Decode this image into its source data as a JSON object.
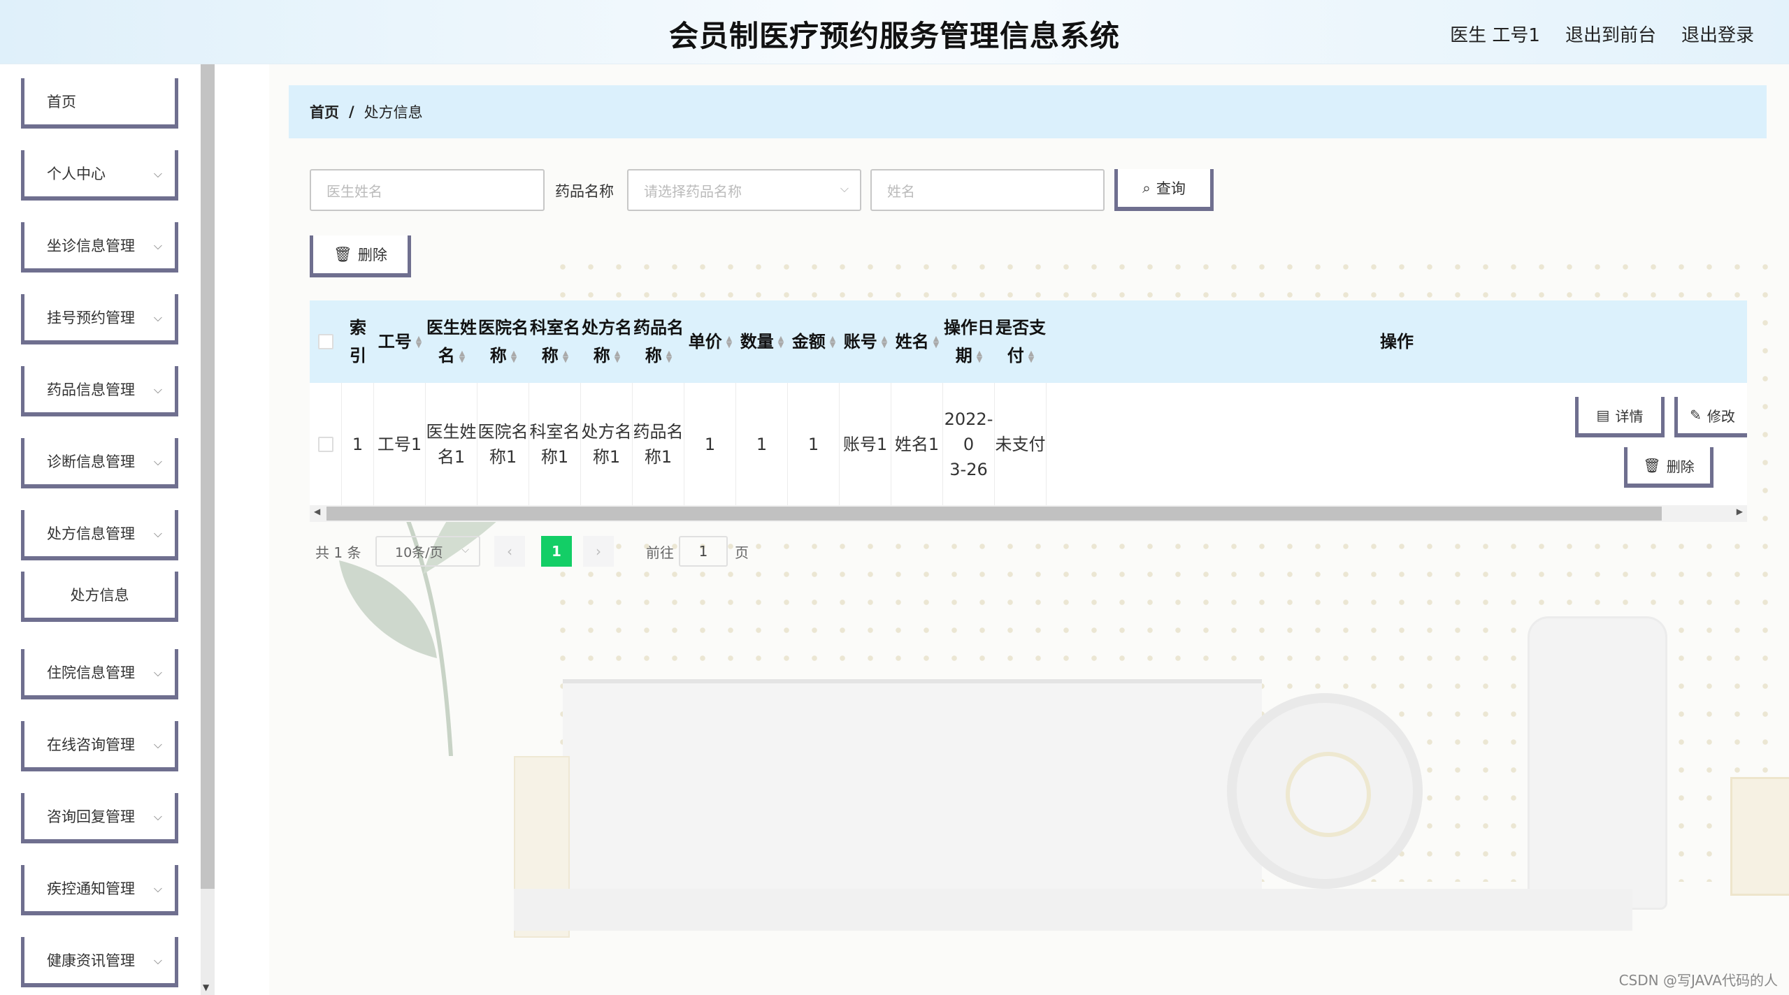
{
  "header": {
    "title": "会员制医疗预约服务管理信息系统",
    "user": "医生 工号1",
    "to_front": "退出到前台",
    "logout": "退出登录"
  },
  "sidebar": {
    "items": [
      {
        "label": "首页"
      },
      {
        "label": "个人中心"
      },
      {
        "label": "坐诊信息管理"
      },
      {
        "label": "挂号预约管理"
      },
      {
        "label": "药品信息管理"
      },
      {
        "label": "诊断信息管理"
      },
      {
        "label": "处方信息管理"
      },
      {
        "label": "处方信息"
      },
      {
        "label": "住院信息管理"
      },
      {
        "label": "在线咨询管理"
      },
      {
        "label": "咨询回复管理"
      },
      {
        "label": "疾控通知管理"
      },
      {
        "label": "健康资讯管理"
      }
    ]
  },
  "breadcrumb": {
    "home": "首页",
    "sep": "/",
    "current": "处方信息"
  },
  "search": {
    "doctor_placeholder": "医生姓名",
    "drug_label": "药品名称",
    "drug_placeholder": "请选择药品名称",
    "name_placeholder": "姓名",
    "query_button": "查询"
  },
  "actions": {
    "delete_button": "删除"
  },
  "table": {
    "headers": {
      "index": [
        "索",
        "引"
      ],
      "staff_no": "工号",
      "doctor_name": [
        "医生姓",
        "名"
      ],
      "hospital": [
        "医院名",
        "称"
      ],
      "dept": [
        "科室名",
        "称"
      ],
      "prescription": [
        "处方名",
        "称"
      ],
      "drug": [
        "药品名",
        "称"
      ],
      "unit_price": "单价",
      "quantity": "数量",
      "amount": "金额",
      "account": "账号",
      "name": "姓名",
      "op_date": [
        "操作日",
        "期"
      ],
      "paid": [
        "是否支",
        "付"
      ],
      "operation": "操作"
    },
    "row": {
      "index": "1",
      "staff_no": "工号1",
      "doctor_name": [
        "医生姓",
        "名1"
      ],
      "hospital": [
        "医院名",
        "称1"
      ],
      "dept": [
        "科室名",
        "称1"
      ],
      "prescription": [
        "处方名",
        "称1"
      ],
      "drug": [
        "药品名",
        "称1"
      ],
      "unit_price": "1",
      "quantity": "1",
      "amount": "1",
      "account": "账号1",
      "name": "姓名1",
      "op_date": [
        "2022-0",
        "3-26"
      ],
      "paid": "未支付",
      "detail": "详情",
      "edit": "修改",
      "delete": "删除"
    }
  },
  "pagination": {
    "total": "共 1 条",
    "page_size": "10条/页",
    "current": "1",
    "goto": "前往",
    "page_value": "1",
    "page_suffix": "页"
  },
  "watermark": "CSDN @写JAVA代码的人",
  "colors": {
    "accent": "#13ce66",
    "header_bg": "#dbf0fc",
    "button_border": "#6f6f8f"
  }
}
